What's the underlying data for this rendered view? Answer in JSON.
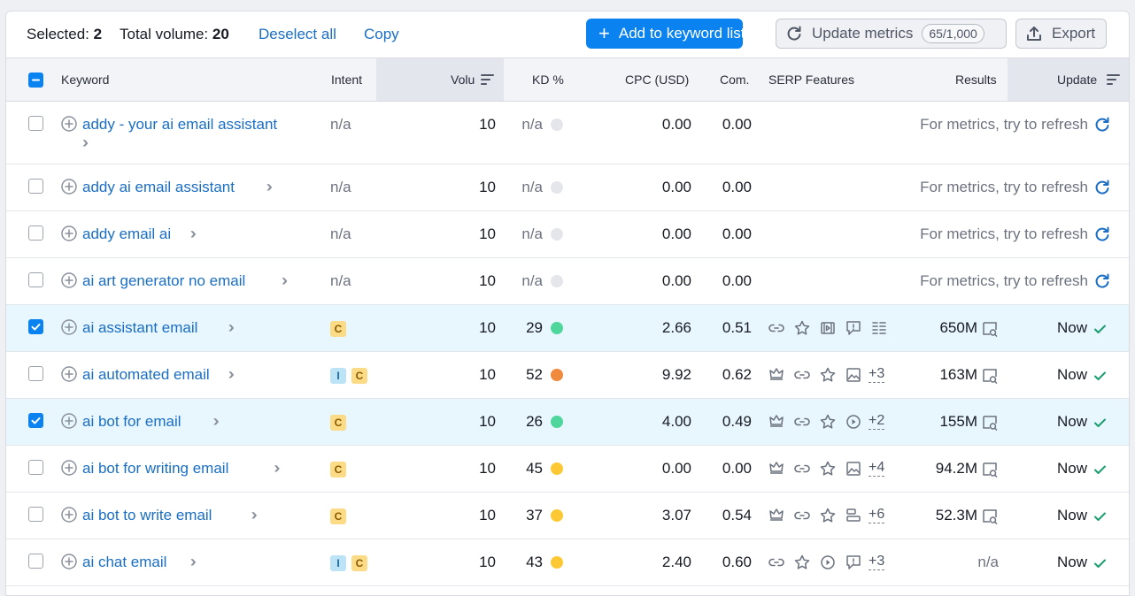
{
  "toolbar": {
    "selected_label": "Selected:",
    "selected_count": "2",
    "total_volume_label": "Total volume:",
    "total_volume_value": "20",
    "deselect_all": "Deselect all",
    "copy": "Copy",
    "add_to_list": "Add to keyword list",
    "update_metrics": "Update metrics",
    "update_quota": "65/1,000",
    "export": "Export"
  },
  "columns": {
    "keyword": "Keyword",
    "intent": "Intent",
    "volume": "Volu",
    "kd": "KD %",
    "cpc": "CPC (USD)",
    "com": "Com.",
    "serp": "SERP Features",
    "results": "Results",
    "updated": "Update"
  },
  "refresh_text": "For metrics, try to refresh",
  "rows": [
    {
      "keyword": "addy - your ai email assistant",
      "wrap": true,
      "selected": false,
      "intent": "n/a",
      "badges": [],
      "volume": "10",
      "kd": "n/a",
      "kd_color": "#e4e6eb",
      "cpc": "0.00",
      "com": "0.00",
      "refresh": true
    },
    {
      "keyword": "addy ai email assistant",
      "selected": false,
      "intent": "n/a",
      "badges": [],
      "volume": "10",
      "kd": "n/a",
      "kd_color": "#e4e6eb",
      "cpc": "0.00",
      "com": "0.00",
      "refresh": true
    },
    {
      "keyword": "addy email ai",
      "selected": false,
      "intent": "n/a",
      "badges": [],
      "volume": "10",
      "kd": "n/a",
      "kd_color": "#e4e6eb",
      "cpc": "0.00",
      "com": "0.00",
      "refresh": true
    },
    {
      "keyword": "ai art generator no email",
      "selected": false,
      "intent": "n/a",
      "badges": [],
      "volume": "10",
      "kd": "n/a",
      "kd_color": "#e4e6eb",
      "cpc": "0.00",
      "com": "0.00",
      "refresh": true
    },
    {
      "keyword": "ai assistant email",
      "selected": true,
      "intent": "",
      "badges": [
        "C"
      ],
      "volume": "10",
      "kd": "29",
      "kd_color": "#4fd69c",
      "cpc": "2.66",
      "com": "0.51",
      "serp": [
        "link",
        "star",
        "video",
        "review",
        "list"
      ],
      "more": "",
      "results": "650M",
      "updated": "Now"
    },
    {
      "keyword": "ai automated email",
      "selected": false,
      "intent": "",
      "badges": [
        "I",
        "C"
      ],
      "volume": "10",
      "kd": "52",
      "kd_color": "#f08a3c",
      "cpc": "9.92",
      "com": "0.62",
      "serp": [
        "crown",
        "link",
        "star",
        "image"
      ],
      "more": "+3",
      "results": "163M",
      "updated": "Now"
    },
    {
      "keyword": "ai bot for email",
      "selected": true,
      "intent": "",
      "badges": [
        "C"
      ],
      "volume": "10",
      "kd": "26",
      "kd_color": "#4fd69c",
      "cpc": "4.00",
      "com": "0.49",
      "serp": [
        "crown",
        "link",
        "star",
        "play"
      ],
      "more": "+2",
      "results": "155M",
      "updated": "Now"
    },
    {
      "keyword": "ai bot for writing email",
      "selected": false,
      "intent": "",
      "badges": [
        "C"
      ],
      "volume": "10",
      "kd": "45",
      "kd_color": "#fcc934",
      "cpc": "0.00",
      "com": "0.00",
      "serp": [
        "crown",
        "link",
        "star",
        "image"
      ],
      "more": "+4",
      "results": "94.2M",
      "updated": "Now"
    },
    {
      "keyword": "ai bot to write email",
      "selected": false,
      "intent": "",
      "badges": [
        "C"
      ],
      "volume": "10",
      "kd": "37",
      "kd_color": "#fcc934",
      "cpc": "3.07",
      "com": "0.54",
      "serp": [
        "crown",
        "link",
        "star",
        "table"
      ],
      "more": "+6",
      "results": "52.3M",
      "updated": "Now"
    },
    {
      "keyword": "ai chat email",
      "selected": false,
      "intent": "",
      "badges": [
        "I",
        "C"
      ],
      "volume": "10",
      "kd": "43",
      "kd_color": "#fcc934",
      "cpc": "2.40",
      "com": "0.60",
      "serp": [
        "link",
        "star",
        "play",
        "review"
      ],
      "more": "+3",
      "results": "n/a",
      "updated": "Now"
    }
  ]
}
